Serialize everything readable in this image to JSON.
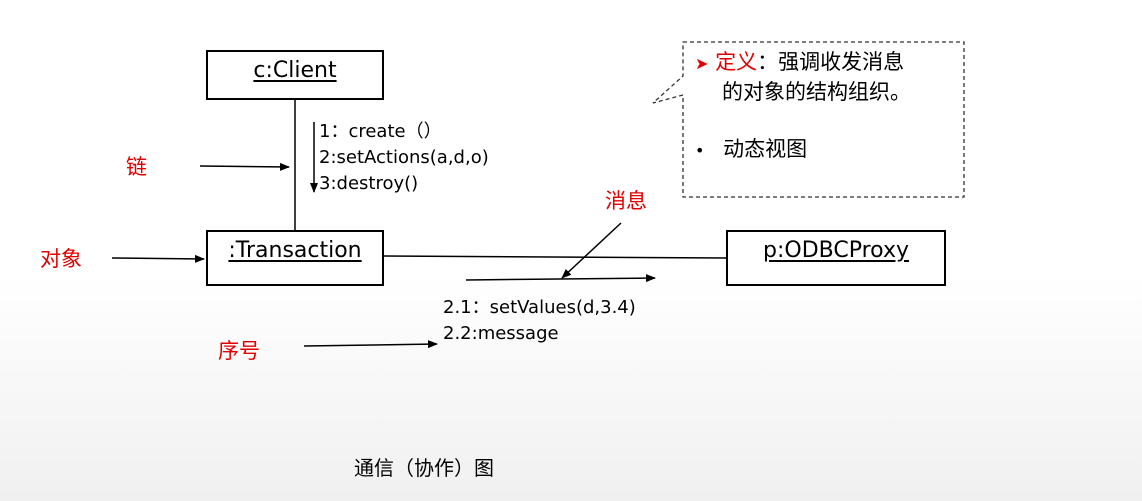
{
  "objects": {
    "client": "c:Client",
    "transaction": ":Transaction",
    "proxy": "p:ODBCProxy"
  },
  "messages_client": {
    "line1": "1：create（）",
    "line2": "2:setActions(a,d,o)",
    "line3": "3:destroy()"
  },
  "messages_proxy": {
    "line1": "2.1：setValues(d,3.4)",
    "line2": "2.2:message"
  },
  "labels": {
    "link": "链",
    "object": "对象",
    "message": "消息",
    "sequence": "序号"
  },
  "note": {
    "bullet1_marker": "➤",
    "bullet1_term": "定义",
    "bullet1_rest_line1": "：强调收发消息",
    "bullet1_line2": "的对象的结构组织。",
    "bullet2_marker": "•",
    "bullet2_text": "动态视图"
  },
  "caption": "通信（协作）图",
  "colors": {
    "label_red": "#e00000",
    "line": "#000000",
    "note_border": "#333333"
  }
}
